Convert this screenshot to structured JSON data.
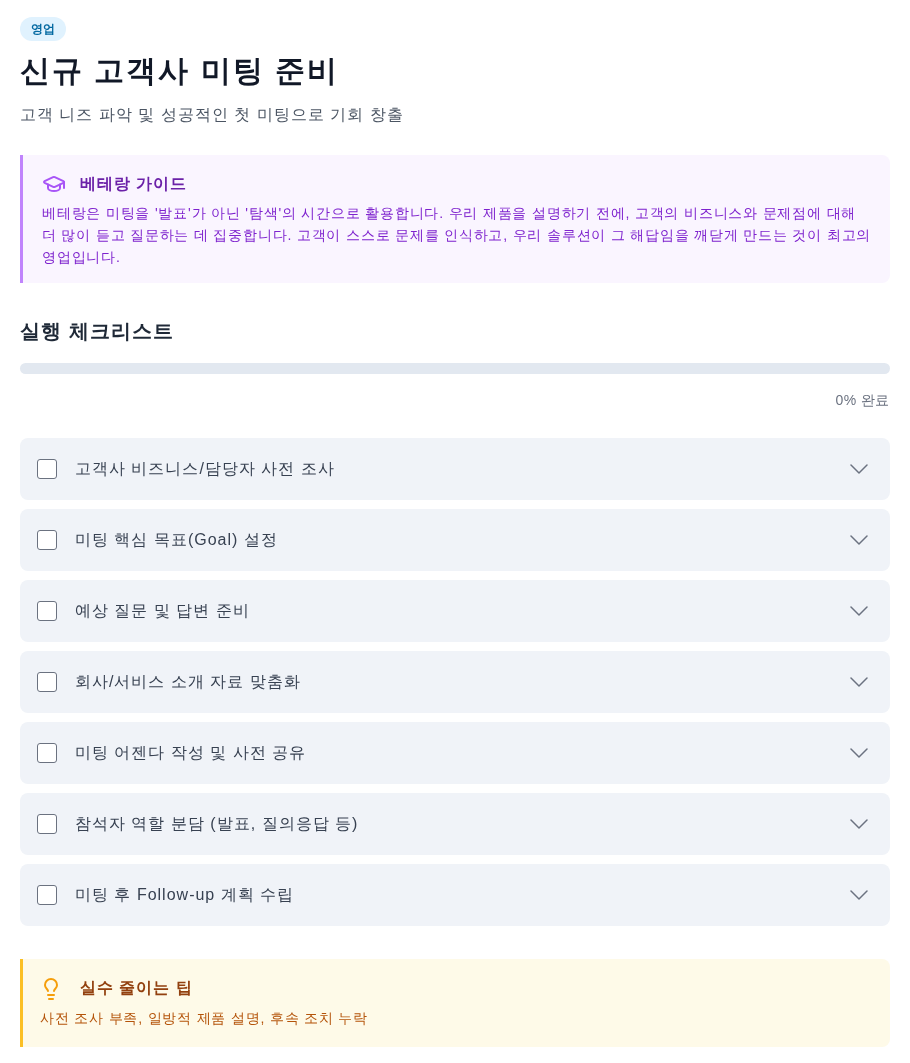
{
  "badge": "영업",
  "title": "신규 고객사 미팅 준비",
  "subtitle": "고객 니즈 파악 및 성공적인 첫 미팅으로 기회 창출",
  "guide": {
    "title": "베테랑 가이드",
    "text": "베테랑은 미팅을 '발표'가 아닌 '탐색'의 시간으로 활용합니다. 우리 제품을 설명하기 전에, 고객의 비즈니스와 문제점에 대해 더 많이 듣고 질문하는 데 집중합니다. 고객이 스스로 문제를 인식하고, 우리 솔루션이 그 해답임을 깨닫게 만드는 것이 최고의 영업입니다."
  },
  "checklist": {
    "title": "실행 체크리스트",
    "progress": {
      "level": 0,
      "label": "0% 완료"
    },
    "items": [
      {
        "label": "고객사 비즈니스/담당자 사전 조사",
        "checked": false,
        "expanded": false
      },
      {
        "label": "미팅 핵심 목표(Goal) 설정",
        "checked": false,
        "expanded": false
      },
      {
        "label": "예상 질문 및 답변 준비",
        "checked": false,
        "expanded": false
      },
      {
        "label": "회사/서비스 소개 자료 맞춤화",
        "checked": false,
        "expanded": false
      },
      {
        "label": "미팅 어젠다 작성 및 사전 공유",
        "checked": false,
        "expanded": false
      },
      {
        "label": "참석자 역할 분담 (발표, 질의응답 등)",
        "checked": false,
        "expanded": false
      },
      {
        "label": "미팅 후 Follow-up 계획 수립",
        "checked": false,
        "expanded": false
      }
    ]
  },
  "tip": {
    "title": "실수 줄이는 팁",
    "text": "사전 조사 부족, 일방적 제품 설명, 후속 조치 누락"
  }
}
